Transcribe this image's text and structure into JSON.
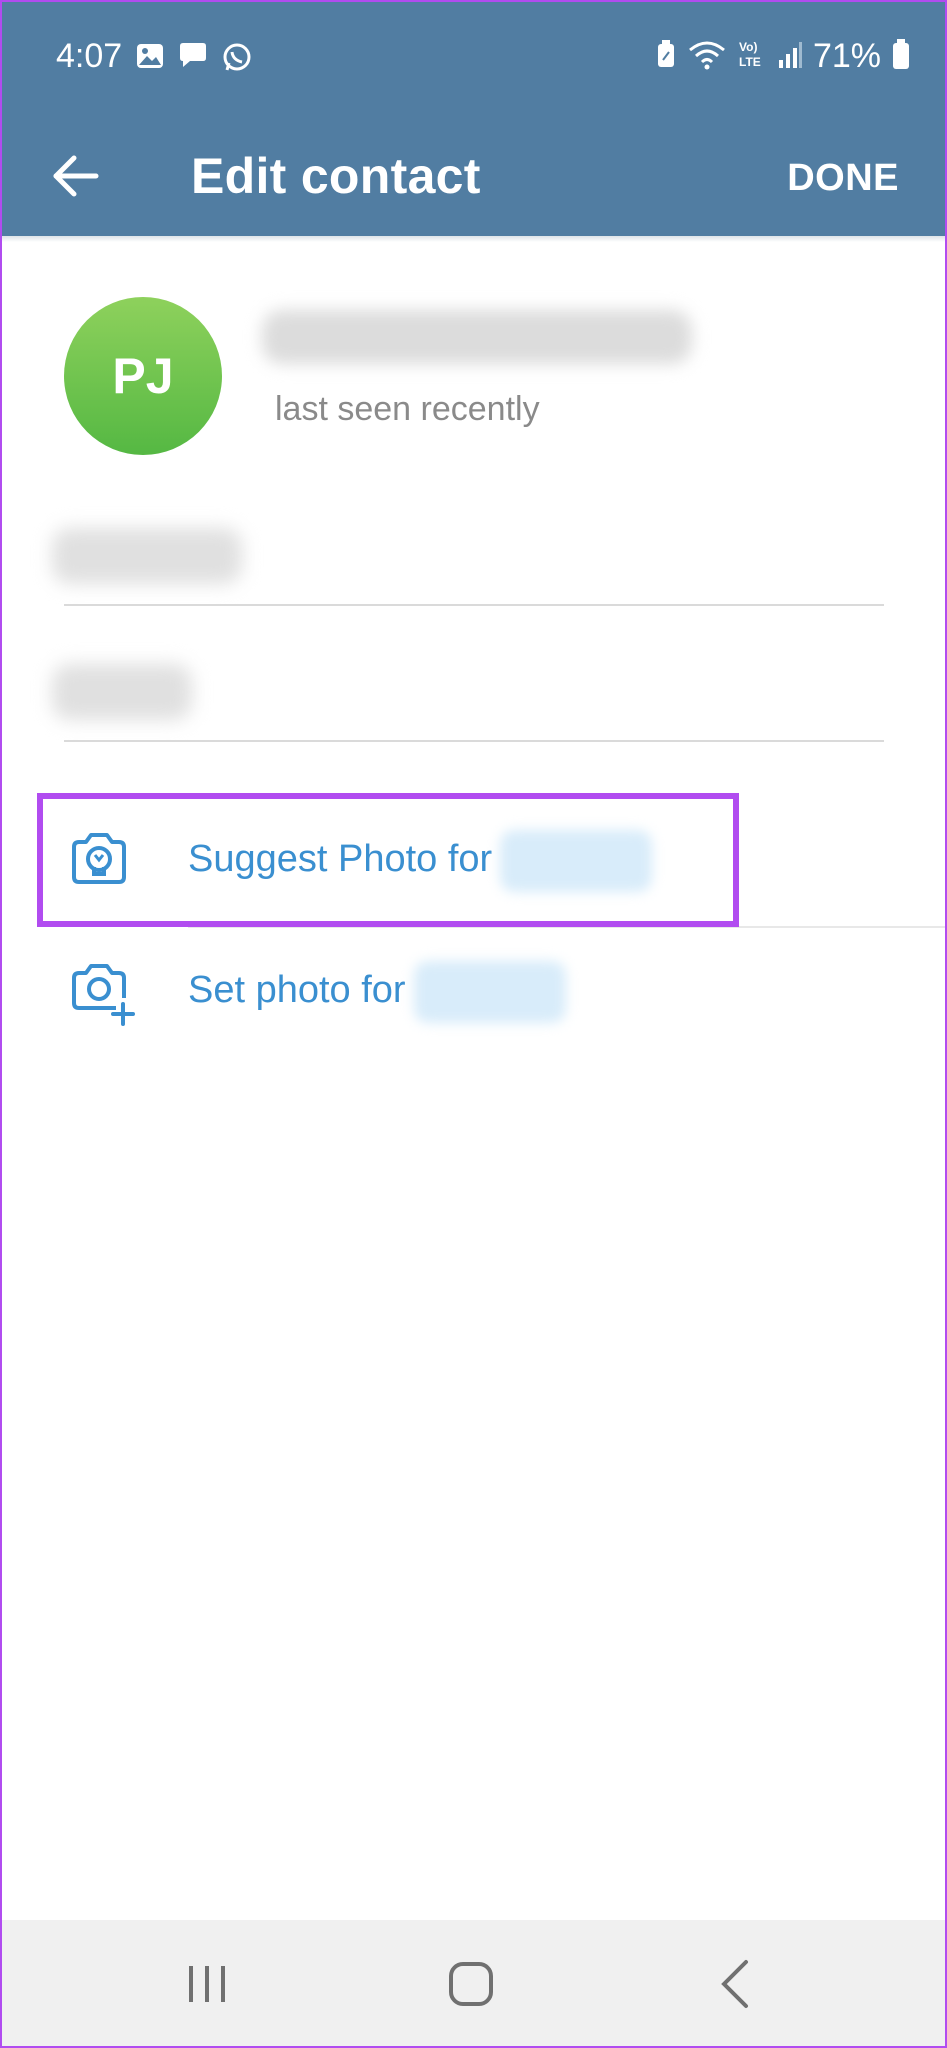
{
  "status_bar": {
    "time": "4:07",
    "battery_percent": "71%",
    "left_icons": [
      "gallery-icon",
      "message-bubble-icon",
      "whatsapp-icon"
    ],
    "right_icons": [
      "battery-saver-icon",
      "wifi-icon",
      "volte-icon",
      "signal-icon",
      "battery-icon"
    ]
  },
  "app_bar": {
    "title": "Edit contact",
    "done_label": "DONE",
    "back_icon": "arrow-left-icon"
  },
  "profile": {
    "initials": "PJ",
    "name": "",
    "status": "last seen recently",
    "avatar_color": "#6cc24f"
  },
  "fields": {
    "first_name": "",
    "last_name": ""
  },
  "actions": {
    "suggest_photo_label": "Suggest Photo for",
    "suggest_photo_name": "",
    "set_photo_label": "Set photo for",
    "set_photo_name": ""
  },
  "colors": {
    "header": "#517da2",
    "accent": "#3a8fd0",
    "highlight": "#b14cf0"
  }
}
